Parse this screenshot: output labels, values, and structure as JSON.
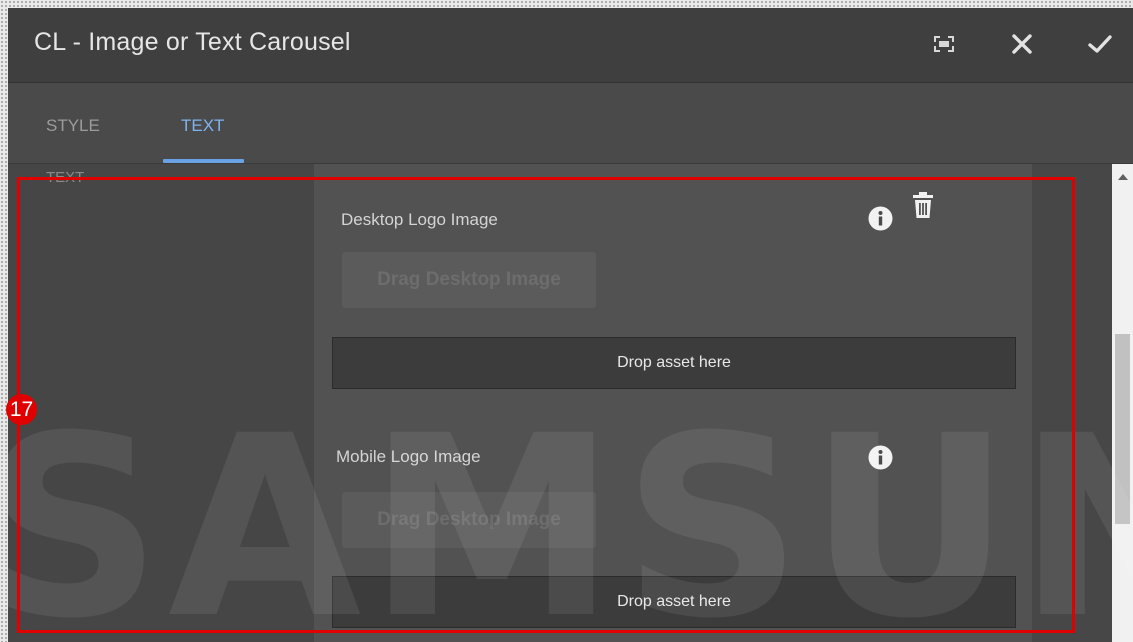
{
  "dialog": {
    "title": "CL - Image or Text Carousel",
    "icons": [
      "fullscreen-icon",
      "close-icon",
      "check-icon"
    ]
  },
  "tabs": [
    {
      "label": "STYLE",
      "active": false
    },
    {
      "label": "TEXT",
      "active": true
    }
  ],
  "left_column": {
    "label": "TEXT"
  },
  "fields": [
    {
      "label": "Desktop Logo Image",
      "drag_button": "Drag Desktop Image",
      "drop_zone": "Drop asset here",
      "has_delete": true
    },
    {
      "label": "Mobile Logo Image",
      "drag_button": "Drag Desktop Image",
      "drop_zone": "Drop asset here",
      "has_delete": false
    }
  ],
  "annotation": {
    "step_number": "17",
    "highlight_color": "#e00000"
  },
  "watermark": "SAMSUNG",
  "colors": {
    "accent_tab": "#7fb2f0",
    "titlebar": "#3f3f3f",
    "panel": "#525252"
  }
}
